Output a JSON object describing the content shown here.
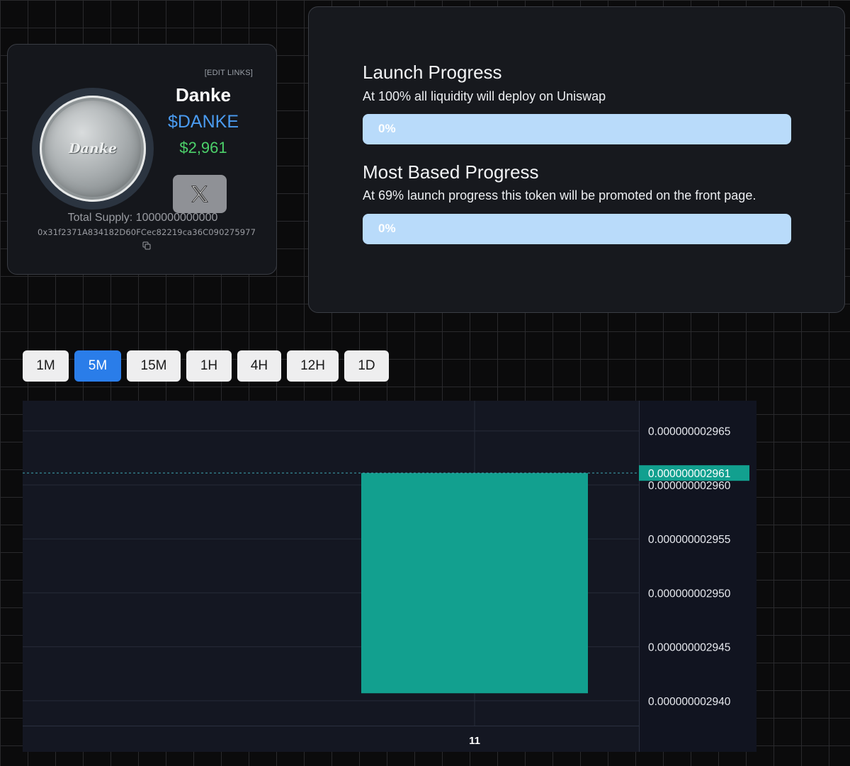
{
  "token": {
    "edit_links": "[EDIT LINKS]",
    "avatar_text": "Danke",
    "name": "Danke",
    "ticker": "$DANKE",
    "price": "$2,961",
    "social_icon": "x-logo-icon",
    "total_supply": "Total Supply: 1000000000000",
    "contract_address": "0x31f2371A834182D60FCec82219ca36C090275977",
    "copy_icon": "copy-icon"
  },
  "launch_progress": {
    "title": "Launch Progress",
    "description": "At 100% all liquidity will deploy on Uniswap",
    "label": "0%",
    "value": 0
  },
  "based_progress": {
    "title": "Most Based Progress",
    "description": "At 69% launch progress this token will be promoted on the front page.",
    "label": "0%",
    "value": 0
  },
  "intervals": {
    "items": [
      "1M",
      "5M",
      "15M",
      "1H",
      "4H",
      "12H",
      "1D"
    ],
    "selected": "5M"
  },
  "colors": {
    "accent": "#2a7de9",
    "ticker": "#4a9bf0",
    "price": "#4cd16a",
    "candle": "#12a08f",
    "progress_track": "#b9dbfa"
  },
  "chart_data": {
    "type": "candlestick",
    "x": [
      "11"
    ],
    "candles": [
      {
        "x": "11",
        "open": 2.9407e-09,
        "high": 2.9611e-09,
        "low": 2.9407e-09,
        "close": 2.9611e-09
      }
    ],
    "y_ticks": [
      "0.000000002965",
      "0.000000002960",
      "0.000000002955",
      "0.000000002950",
      "0.000000002945",
      "0.000000002940"
    ],
    "ylim": [
      2.9377e-09,
      2.9678e-09
    ],
    "current_price_label": "0.000000002961",
    "current_price": 2.9611e-09,
    "x_tick_label": "11",
    "grid": true
  }
}
